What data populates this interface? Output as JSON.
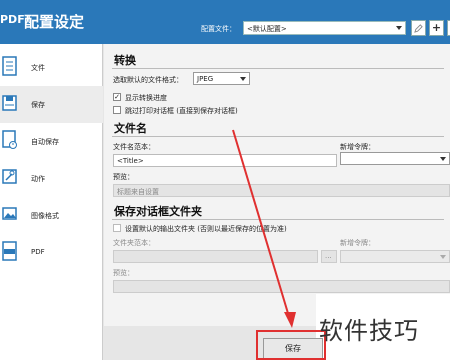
{
  "title_bar": {
    "app_icon_text": "PDF",
    "title": "配置设定",
    "config_label": "配置文件：",
    "config_value": "<默认配置>",
    "buttons": [
      "pencil-icon",
      "plus-icon",
      "trash-icon"
    ]
  },
  "sidebar": {
    "items": [
      {
        "label": "文件",
        "icon": "document-icon",
        "active": false
      },
      {
        "label": "保存",
        "icon": "save-icon",
        "active": true
      },
      {
        "label": "自动保存",
        "icon": "auto-save-icon",
        "active": false
      },
      {
        "label": "动作",
        "icon": "wrench-icon",
        "active": false
      },
      {
        "label": "图像格式",
        "icon": "image-icon",
        "active": false
      },
      {
        "label": "PDF",
        "icon": "pdf-file-icon",
        "active": false
      }
    ]
  },
  "convert": {
    "title": "转换",
    "format_label": "选取默认的文件格式：",
    "format_value": "JPEG",
    "show_progress_label": "显示转换进度",
    "show_progress_checked": true,
    "skip_print_label": "跳过打印对话框 (直接到保存对话框)",
    "skip_print_checked": false
  },
  "filename": {
    "title": "文件名",
    "pattern_label": "文件名范本：",
    "pattern_value": "<Title>",
    "token_label": "新增令牌：",
    "preview_label": "预览：",
    "preview_value": "标题来自设置"
  },
  "save_dialog_folder": {
    "title": "保存对话框文件夹",
    "default_folder_label": "设置默认的输出文件夹 (否则以最近保存的位置为准)",
    "default_folder_checked": false,
    "folder_pattern_label": "文件夹范本：",
    "token_label": "新增令牌：",
    "browse_label": "...",
    "preview_label": "预览："
  },
  "footer": {
    "save_button_label": "保存"
  },
  "watermark": "软件技巧",
  "colors": {
    "title_bar": "#2a78b9",
    "highlight_box": "#e03030"
  }
}
